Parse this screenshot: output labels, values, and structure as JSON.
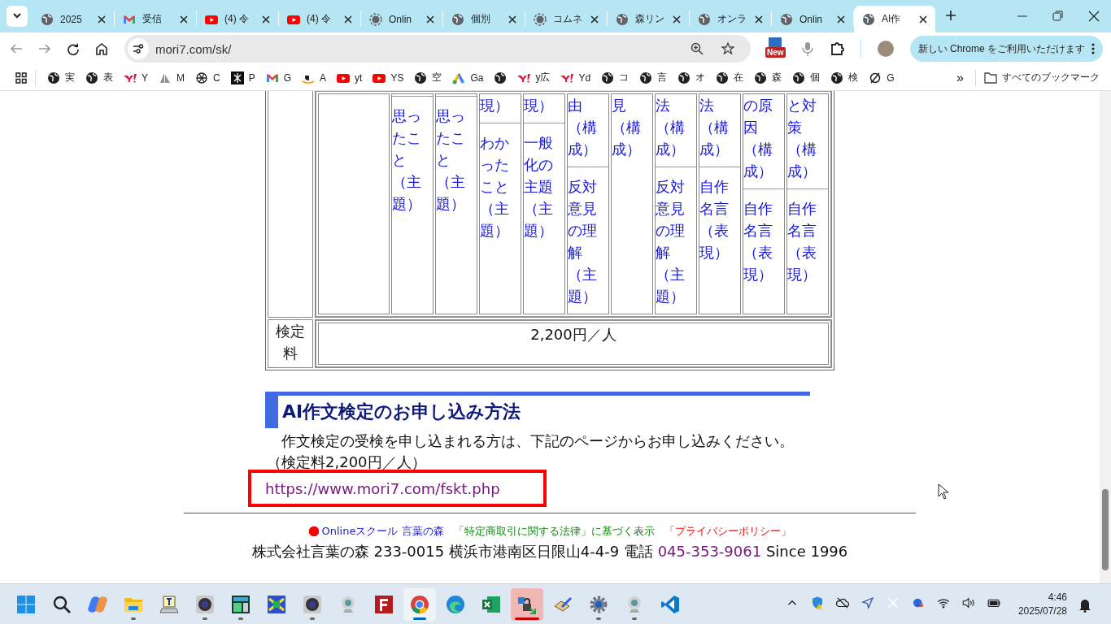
{
  "tabs": [
    {
      "title": "2025",
      "kind": "globe",
      "selected": false
    },
    {
      "title": "受信",
      "kind": "mail",
      "selected": false
    },
    {
      "title": "(4) 令",
      "kind": "play",
      "selected": false
    },
    {
      "title": "(4) 令",
      "kind": "play",
      "selected": false
    },
    {
      "title": "Onlin",
      "kind": "loading",
      "selected": false
    },
    {
      "title": "個別",
      "kind": "globe",
      "selected": false
    },
    {
      "title": "コムネ",
      "kind": "loading",
      "selected": false
    },
    {
      "title": "森リン",
      "kind": "globe",
      "selected": false
    },
    {
      "title": "オンラ",
      "kind": "globe",
      "selected": false
    },
    {
      "title": "Onlin",
      "kind": "globe",
      "selected": false
    },
    {
      "title": "AI作",
      "kind": "globe",
      "selected": true
    }
  ],
  "toolbar": {
    "url": "mori7.com/sk/",
    "extension_badge": "New",
    "update_button": "新しい Chrome をご利用いただけます"
  },
  "bookmarks": [
    {
      "label": "実",
      "kind": "globe"
    },
    {
      "label": "表",
      "kind": "globe"
    },
    {
      "label": "Y",
      "kind": "yahoo"
    },
    {
      "label": "M",
      "kind": "sail"
    },
    {
      "label": "C",
      "kind": "knot"
    },
    {
      "label": "P",
      "kind": "tile"
    },
    {
      "label": "G",
      "kind": "mail"
    },
    {
      "label": "A",
      "kind": "smile"
    },
    {
      "label": "yt",
      "kind": "play"
    },
    {
      "label": "YS",
      "kind": "play"
    },
    {
      "label": "空",
      "kind": "globe"
    },
    {
      "label": "Ga",
      "kind": "ads"
    },
    {
      "kind": "globe"
    },
    {
      "label": "y広",
      "kind": "yahoo"
    },
    {
      "label": "Yd",
      "kind": "yahoo"
    },
    {
      "label": "コ",
      "kind": "globe"
    },
    {
      "label": "言",
      "kind": "globe"
    },
    {
      "label": "オ",
      "kind": "globe"
    },
    {
      "label": "在",
      "kind": "globe"
    },
    {
      "label": "森",
      "kind": "globe"
    },
    {
      "label": "個",
      "kind": "globe"
    },
    {
      "label": "検",
      "kind": "globe"
    },
    {
      "label": "G",
      "kind": "slash"
    }
  ],
  "bookmarks_overflow": "»",
  "all_bookmarks": "すべてのブックマーク",
  "exam_table": {
    "subject_cells": [
      {
        "divider_top": true,
        "segments": [
          "思ったこと（主題）"
        ]
      },
      {
        "divider_top": true,
        "segments": [
          "思ったこと（主題）"
        ]
      },
      {
        "divider_top": false,
        "segments": [
          "現）",
          "わかったこと（主題）"
        ]
      },
      {
        "divider_top": false,
        "segments": [
          "現）",
          "一般化の主題（主題）"
        ]
      },
      {
        "divider_top": false,
        "segments": [
          "由（構成）",
          "反対意見の理解（主題）"
        ]
      },
      {
        "divider_top": false,
        "segments": [
          "見（構成）"
        ]
      },
      {
        "divider_top": false,
        "segments": [
          "法（構成）",
          "反対意見の理解（主題）"
        ]
      },
      {
        "divider_top": false,
        "segments": [
          "法（構成）",
          "自作名言（表現）"
        ]
      },
      {
        "divider_top": false,
        "segments": [
          "の原因（構成）",
          "自作名言（表現）"
        ]
      },
      {
        "divider_top": false,
        "segments": [
          "と対策（構成）",
          "自作名言（表現）"
        ]
      }
    ],
    "fee_label": "検定料",
    "fee_value": "2,200円／人"
  },
  "application": {
    "heading": "AI作文検定のお申し込み方法",
    "intro": "作文検定の受検を申し込まれる方は、下記のページからお申し込みください。",
    "fee_note": "（検定料2,200円／人）",
    "link": "https://www.mori7.com/fskt.php"
  },
  "footer": {
    "links": [
      {
        "text": "Onlineスクール 言葉の森",
        "color": "#1a1ad6",
        "bullet": true
      },
      {
        "text": "「特定商取引に関する法律」に基づく表示",
        "color": "#108a10",
        "bullet": false
      },
      {
        "text": "「プライバシーポリシー」",
        "color": "#ee1111",
        "bullet": false
      }
    ],
    "address": "株式会社言葉の森 233-0015 横浜市港南区日限山4-4-9 電話",
    "phone": "045-353-9061",
    "since": "Since 1996"
  },
  "taskbar": {
    "apps": [
      {
        "kind": "start",
        "open": false,
        "active": false
      },
      {
        "kind": "search",
        "open": false,
        "active": false
      },
      {
        "kind": "swirl",
        "open": false,
        "active": false
      },
      {
        "kind": "folder",
        "open": true,
        "active": false
      },
      {
        "kind": "notepad",
        "open": false,
        "active": false
      },
      {
        "kind": "camera",
        "open": true,
        "active": false
      },
      {
        "kind": "screen",
        "open": true,
        "active": false
      },
      {
        "kind": "bluetile",
        "open": false,
        "active": false
      },
      {
        "kind": "camera",
        "open": true,
        "active": false
      },
      {
        "kind": "webcam",
        "open": false,
        "active": false
      },
      {
        "kind": "redtile",
        "open": false,
        "active": false
      },
      {
        "kind": "ring",
        "open": true,
        "active": true
      },
      {
        "kind": "wave",
        "open": false,
        "active": false
      },
      {
        "kind": "sheet",
        "open": false,
        "active": false
      },
      {
        "kind": "lock",
        "open": true,
        "active": true
      },
      {
        "kind": "pen",
        "open": false,
        "active": false
      },
      {
        "kind": "settings",
        "open": true,
        "active": false
      },
      {
        "kind": "webcam",
        "open": true,
        "active": false
      },
      {
        "kind": "code",
        "open": false,
        "active": false
      }
    ],
    "tray": [
      {
        "kind": "chevron"
      },
      {
        "kind": "shield"
      },
      {
        "kind": "cloudoff"
      },
      {
        "kind": "send"
      },
      {
        "kind": "x"
      },
      {
        "kind": "blob"
      },
      {
        "kind": "wifi"
      },
      {
        "kind": "volume"
      },
      {
        "kind": "battery"
      }
    ],
    "time": "4:46",
    "date": "2025/07/28"
  }
}
